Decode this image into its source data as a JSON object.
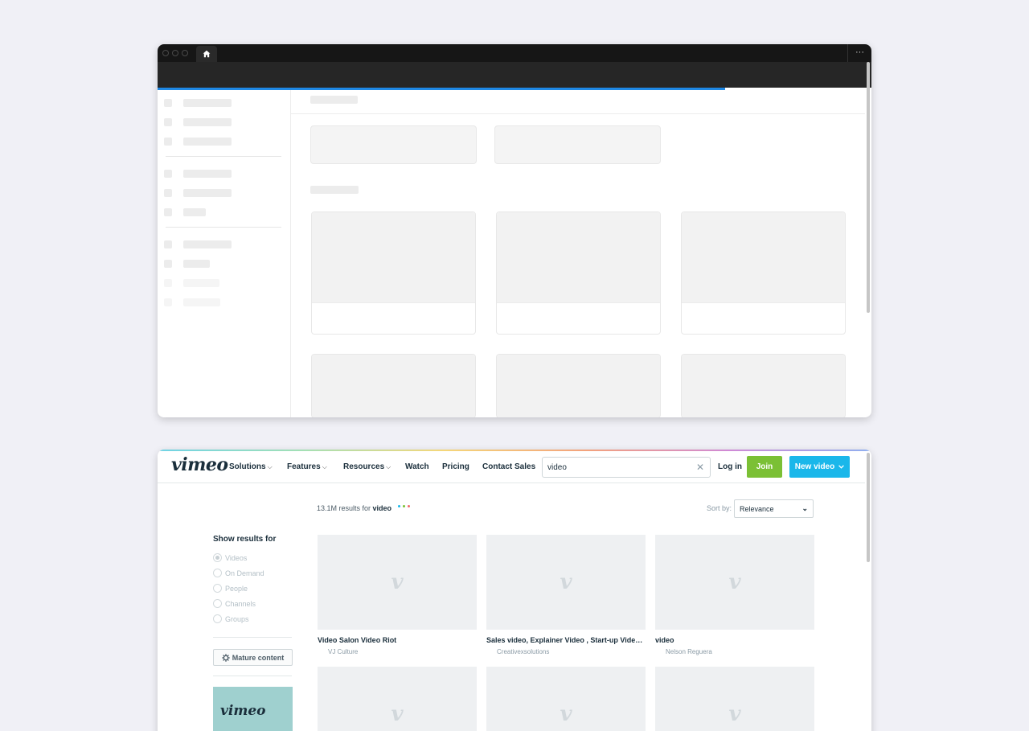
{
  "top_window": {
    "more_glyph": "···"
  },
  "vimeo": {
    "logo": "vimeo",
    "nav": {
      "solutions": "Solutions",
      "features": "Features",
      "resources": "Resources",
      "watch": "Watch",
      "pricing": "Pricing",
      "contact_sales": "Contact Sales"
    },
    "search": {
      "value": "video",
      "clear_glyph": "✕"
    },
    "log_in": "Log in",
    "join": "Join",
    "new_video": "New video",
    "results": {
      "count": "13.1M results for",
      "query": "video"
    },
    "loading_dot_colors": [
      "#1ab7ea",
      "#7bc035",
      "#f06b6b"
    ],
    "sort": {
      "label": "Sort by:",
      "value": "Relevance"
    },
    "filters": {
      "title": "Show results for",
      "options": [
        {
          "label": "Videos",
          "selected": true
        },
        {
          "label": "On Demand",
          "selected": false
        },
        {
          "label": "People",
          "selected": false
        },
        {
          "label": "Channels",
          "selected": false
        },
        {
          "label": "Groups",
          "selected": false
        }
      ],
      "mature_content": "Mature content"
    },
    "promo_logo": "vimeo",
    "videos": [
      {
        "title": "Video Salon Video Riot",
        "author": "VJ Culture"
      },
      {
        "title": "Sales video, Explainer Video , Start-up Video, ...",
        "author": "Creativexsolutions"
      },
      {
        "title": "video",
        "author": "Nelson Reguera"
      },
      {
        "title": "",
        "author": ""
      },
      {
        "title": "",
        "author": ""
      },
      {
        "title": "",
        "author": ""
      }
    ],
    "thumb_glyph": "v",
    "colors": {
      "join": "#7bc035",
      "new_video": "#1ab7ea",
      "text": "#1a2e3b"
    }
  }
}
